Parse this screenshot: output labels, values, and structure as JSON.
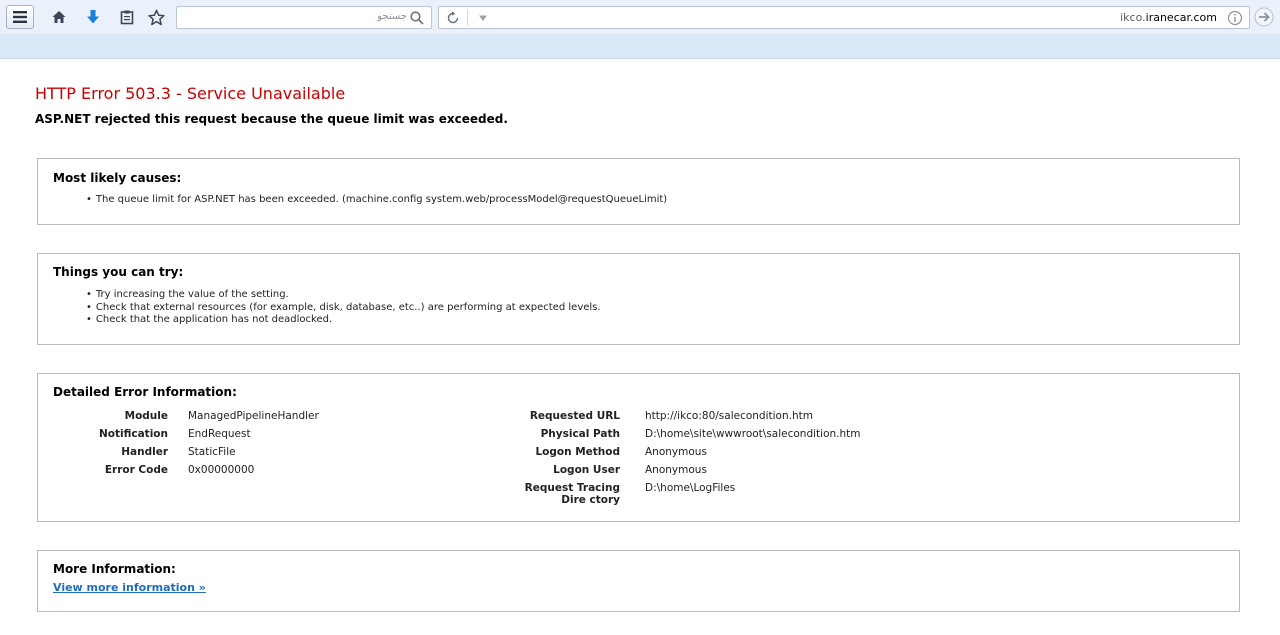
{
  "browser": {
    "search": {
      "placeholder": "جستجو"
    },
    "address": {
      "host_prefix": "ikco.",
      "host_domain": "iranecar.com"
    }
  },
  "error": {
    "title": "HTTP Error 503.3 - Service Unavailable",
    "subtitle": "ASP.NET rejected this request because the queue limit was exceeded."
  },
  "causes": {
    "heading": "Most likely causes:",
    "items": [
      "The queue limit for ASP.NET has been exceeded. (machine.config system.web/processModel@requestQueueLimit)"
    ]
  },
  "try": {
    "heading": "Things you can try:",
    "items": [
      "Try increasing the value of the setting.",
      "Check that external resources (for example, disk, database, etc..) are performing at expected levels.",
      "Check that the application has not deadlocked."
    ]
  },
  "detail": {
    "heading": "Detailed Error Information:",
    "left": [
      {
        "label": "Module",
        "value": "ManagedPipelineHandler"
      },
      {
        "label": "Notification",
        "value": "EndRequest"
      },
      {
        "label": "Handler",
        "value": "StaticFile"
      },
      {
        "label": "Error Code",
        "value": "0x00000000"
      }
    ],
    "right": [
      {
        "label": "Requested URL",
        "value": "http://ikco:80/salecondition.htm"
      },
      {
        "label": "Physical Path",
        "value": "D:\\home\\site\\wwwroot\\salecondition.htm"
      },
      {
        "label": "Logon Method",
        "value": "Anonymous"
      },
      {
        "label": "Logon User",
        "value": "Anonymous"
      },
      {
        "label": "Request Tracing Dire ctory",
        "value": "D:\\home\\LogFiles"
      }
    ]
  },
  "more": {
    "heading": "More Information:",
    "link": "View more information »"
  }
}
